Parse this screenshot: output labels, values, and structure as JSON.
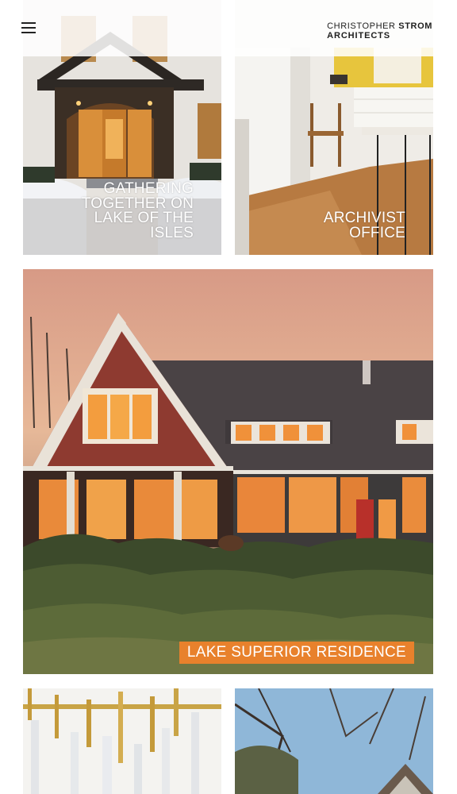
{
  "header": {
    "logo_line1_regular": "CHRISTOPHER ",
    "logo_line1_bold": "STROM",
    "logo_line2": "ARCHITECTS"
  },
  "tiles": [
    {
      "caption_lines": [
        "GATHERING",
        "TOGETHER ON",
        "LAKE OF THE",
        "ISLES"
      ]
    },
    {
      "caption_lines": [
        "ARCHIVIST",
        "OFFICE"
      ]
    },
    {
      "caption": "LAKE SUPERIOR RESIDENCE"
    },
    {
      "caption": ""
    },
    {
      "caption": ""
    }
  ],
  "colors": {
    "badge": "#e8812c",
    "text": "#1e1e1e"
  }
}
